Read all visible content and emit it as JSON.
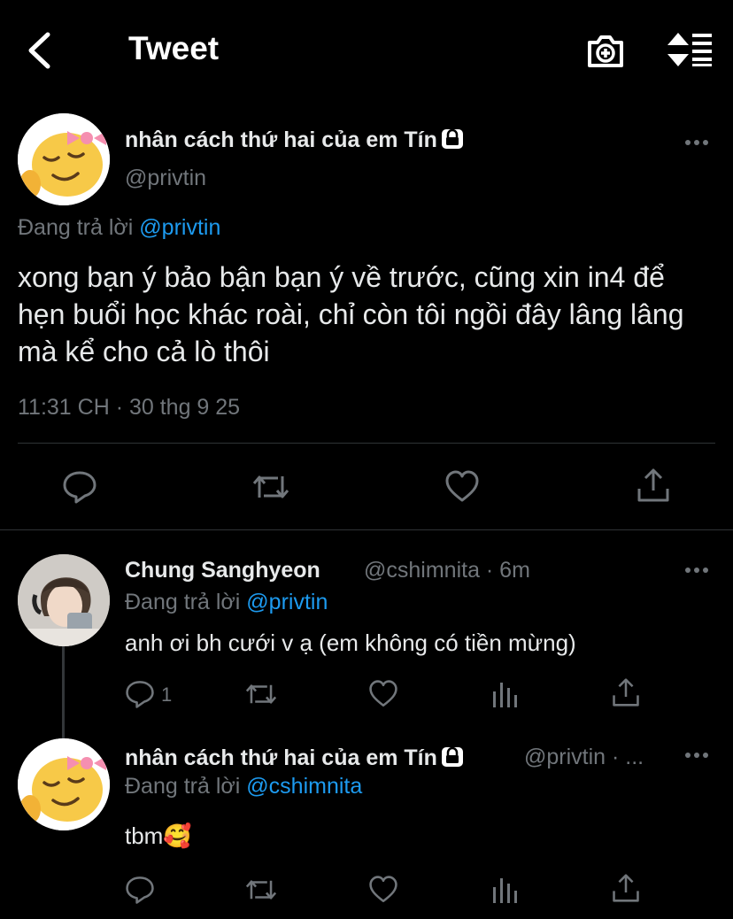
{
  "header": {
    "title": "Tweet",
    "back_icon": "chevron-left-icon",
    "camera_icon": "camera-plus-icon",
    "sort_icon": "sort-icon"
  },
  "main_tweet": {
    "name": "nhân cách thứ hai của em Tín",
    "handle": "@privtin",
    "reply_prefix": "Đang trả lời",
    "reply_mention": "@privtin",
    "text": "xong bạn ý bảo bận bạn ý về trước, cũng xin in4 để hẹn buổi học khác roài, chỉ còn tôi ngồi đây lâng lâng mà kể cho cả lò thôi",
    "timestamp": "11:31 CH · 30 thg 9 25"
  },
  "reply1": {
    "name": "Chung Sanghyeon",
    "handle_time": "@cshimnita · 6m",
    "reply_prefix": "Đang trả lời",
    "reply_mention": "@privtin",
    "text": "anh ơi bh cưới v ạ (em không có tiền mừng)",
    "reply_count": "1"
  },
  "reply2": {
    "name": "nhân cách thứ hai của em Tín",
    "handle_time": "@privtin · ...",
    "reply_prefix": "Đang trả lời",
    "reply_mention": "@cshimnita",
    "text": "tbm🥰"
  },
  "colors": {
    "background": "#000000",
    "text": "#e7e9ea",
    "muted": "#71767b",
    "accent": "#1d9bf0",
    "divider": "#2f3336"
  }
}
